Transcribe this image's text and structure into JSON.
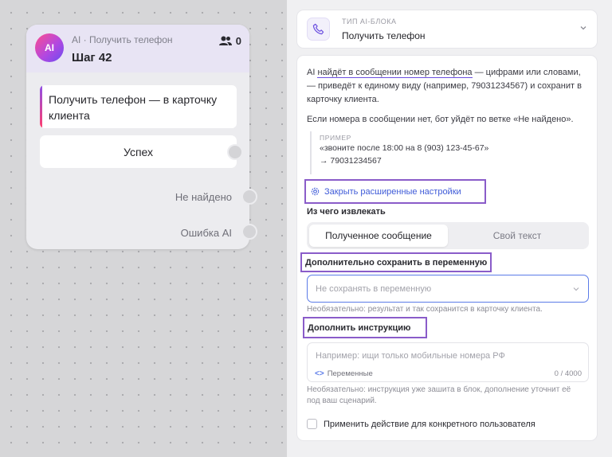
{
  "node": {
    "subtitle": "AI · Получить телефон",
    "title": "Шаг 42",
    "badge": "AI",
    "users_count": "0",
    "action_text": "Получить телефон — в карточку клиента",
    "outputs": {
      "success": "Успех",
      "not_found": "Не найдено",
      "ai_error": "Ошибка AI"
    }
  },
  "panel": {
    "type_label": "ТИП AI-БЛОКА",
    "type_value": "Получить телефон",
    "desc_prefix": "AI ",
    "desc_highlight": "найдёт в сообщении номер телефона",
    "desc_rest": " — цифрами или словами, — приведёт к единому виду (например, 79031234567) и сохранит в карточку клиента.",
    "desc_2": "Если номера в сообщении нет, бот уйдёт по ветке «Не найдено».",
    "example_label": "ПРИМЕР",
    "example_line1": "«звоните после 18:00 на 8 (903) 123-45-67»",
    "example_line2": "→ 79031234567",
    "advanced_link": "Закрыть расширенные настройки",
    "extract_title": "Из чего извлекать",
    "extract_options": [
      "Полученное сообщение",
      "Свой текст"
    ],
    "save_title": "Дополнительно сохранить в переменную",
    "save_placeholder": "Не сохранять в переменную",
    "save_hint": "Необязательно: результат и так сохранится в карточку клиента.",
    "instr_title": "Дополнить инструкцию",
    "instr_placeholder": "Например: ищи только мобильные номера РФ",
    "instr_vars": "Переменные",
    "instr_counter": "0 / 4000",
    "instr_hint": "Необязательно: инструкция уже зашита в блок, дополнение уточнит её под ваш сценарий.",
    "checkbox_label": "Применить действие для конкретного пользователя"
  },
  "colors": {
    "accent": "#8a5cc9",
    "link": "#3f5bd8",
    "focus": "#5b7be8"
  }
}
